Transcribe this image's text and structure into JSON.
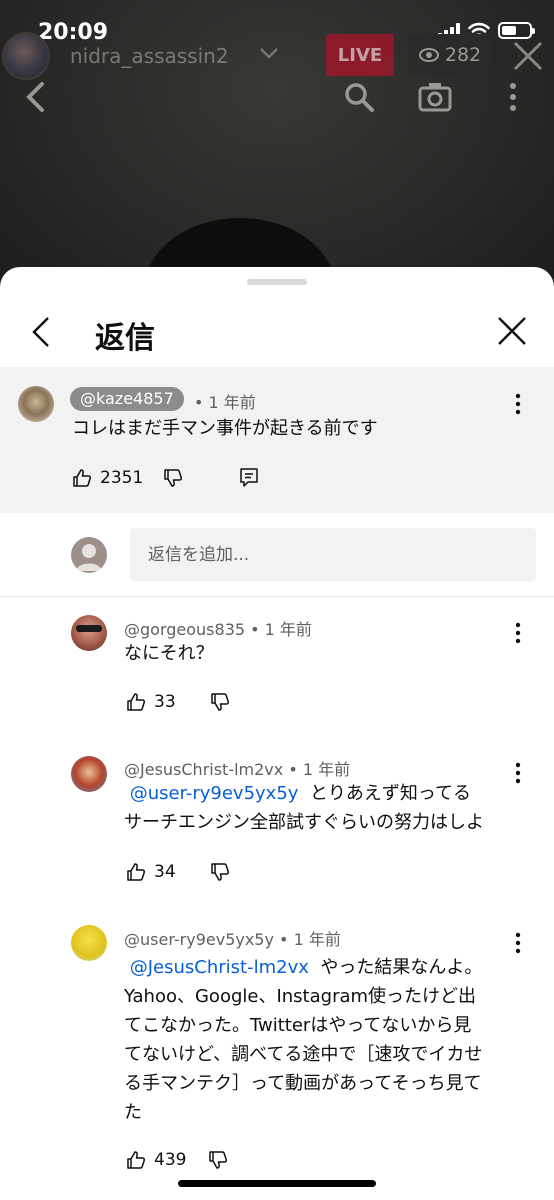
{
  "status_bar": {
    "time": "20:09"
  },
  "live": {
    "username": "nidra_assassin2",
    "badge": "LIVE",
    "viewers": "282"
  },
  "sheet": {
    "title": "返信"
  },
  "parent_comment": {
    "author": "@kaze4857",
    "age": "• 1 年前",
    "text": "コレはまだ手マン事件が起きる前です",
    "likes": "2351"
  },
  "reply_input": {
    "placeholder": "返信を追加..."
  },
  "replies": [
    {
      "author": "@gorgeous835",
      "age": "• 1 年前",
      "text": "なにそれ？",
      "likes": "33"
    },
    {
      "author": "@JesusChrist-lm2vx",
      "age": "• 1 年前",
      "mention": "@user-ry9ev5yx5y",
      "line1": "とりあえず知ってる",
      "line2": "サーチエンジン全部試すぐらいの努力はしよ",
      "likes": "34"
    },
    {
      "author": "@user-ry9ev5yx5y",
      "age": "• 1 年前",
      "mention": "@JesusChrist-lm2vx",
      "line1": "やった結果なんよ。",
      "line2": "Yahoo、Google、Instagram使ったけど出",
      "line3": "てこなかった。Twitterはやってないから見",
      "line4": "てないけど、調べてる途中で［速攻でイカせ",
      "line5": "る手マンテク］って動画があってそっち見て",
      "line6": "た",
      "likes": "439"
    }
  ],
  "colors": {
    "mention": "#065fd4",
    "live_badge": "#a8142a",
    "parent_bg": "#f2f2f2"
  }
}
